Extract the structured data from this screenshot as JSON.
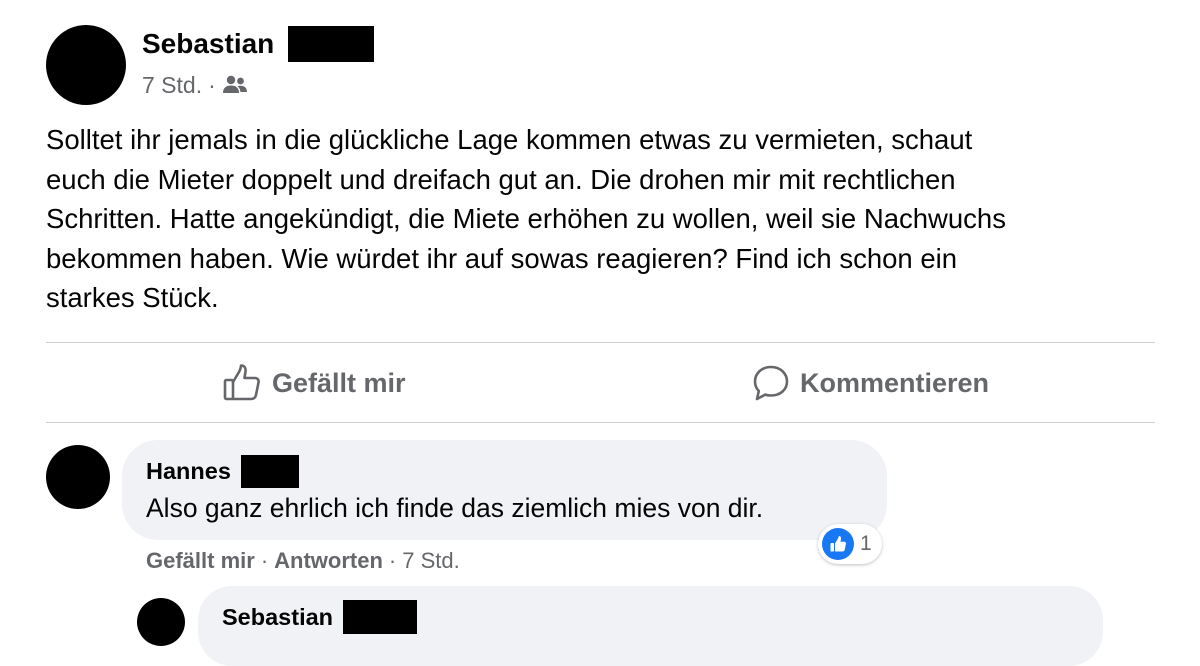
{
  "post": {
    "author_name": "Sebastian",
    "time": "7 Std.",
    "separator": "·",
    "audience_icon": "friends-icon",
    "text": "Solltet ihr jemals in die glückliche Lage kommen etwas zu vermieten, schaut\neuch die Mieter doppelt und dreifach gut an. Die drohen mir mit rechtlichen\nSchritten. Hatte angekündigt, die Miete erhöhen zu wollen, weil sie Nachwuchs\nbekommen haben. Wie würdet ihr auf sowas reagieren? Find ich schon ein\nstarkes Stück."
  },
  "actions": {
    "like_label": "Gefällt mir",
    "like_icon": "thumbs-up-icon",
    "comment_label": "Kommentieren",
    "comment_icon": "speech-bubble-icon"
  },
  "comments": [
    {
      "author_name": "Hannes",
      "text": "Also ganz ehrlich ich finde das ziemlich mies von dir.",
      "like_label": "Gefällt mir",
      "reply_label": "Antworten",
      "time": "7 Std.",
      "separator": "·",
      "reaction_count": "1",
      "reaction_icon": "like-reaction-icon"
    }
  ],
  "reply": {
    "author_name": "Sebastian"
  },
  "colors": {
    "text_primary": "#050505",
    "text_secondary": "#65676b",
    "bubble_bg": "#f0f2f5",
    "divider": "#ced0d4",
    "like_blue": "#1877f2",
    "redaction": "#000000"
  }
}
